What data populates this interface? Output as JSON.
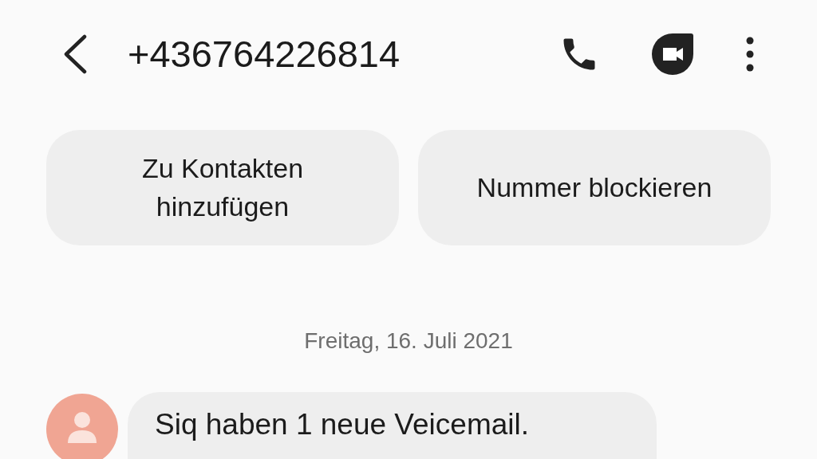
{
  "header": {
    "title": "+436764226814"
  },
  "actions": [
    "Zu Kontakten hinzufügen",
    "Nummer blockieren"
  ],
  "date": "Freitag, 16. Juli 2021",
  "messages": [
    {
      "text": "Siq haben 1 neue Veicemail."
    }
  ]
}
